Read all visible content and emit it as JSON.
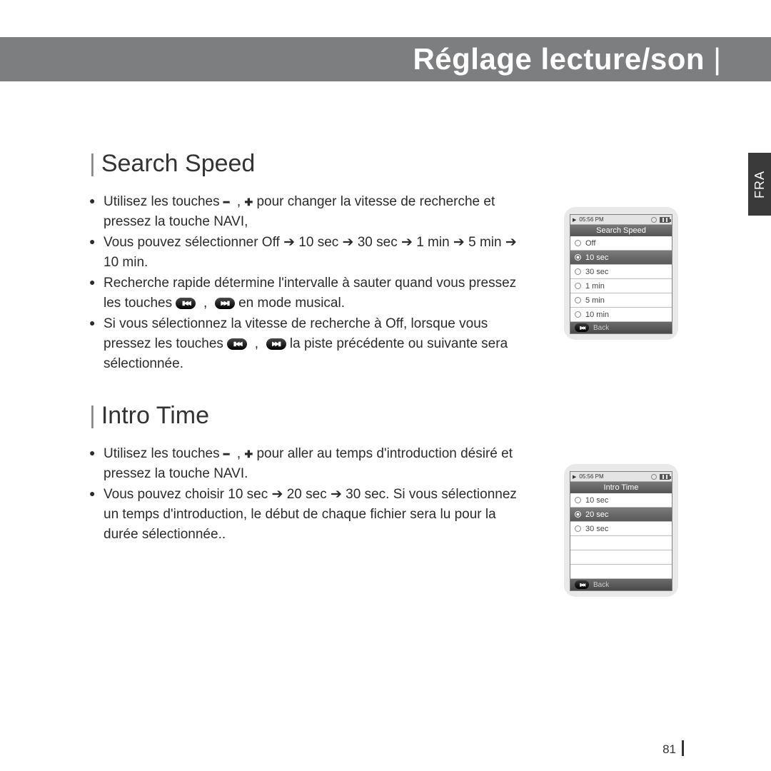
{
  "header": {
    "title": "Réglage lecture/son"
  },
  "side_tab": "FRA",
  "page_number": "81",
  "sections": {
    "search_speed": {
      "heading": "Search Speed",
      "b1a": "Utilisez les touches ",
      "b1b": " pour changer la vitesse de recherche et pressez la touche NAVI,",
      "b2": "Vous pouvez sélectionner Off ➔ 10 sec ➔ 30 sec ➔ 1 min ➔ 5 min ➔ 10 min.",
      "b3a": "Recherche rapide détermine l'intervalle à sauter quand vous pressez les touches ",
      "b3b": " en mode musical.",
      "b4a": "Si vous sélectionnez la vitesse de recherche à Off, lorsque vous pressez les touches ",
      "b4b": " la piste précédente ou suivante sera sélectionnée."
    },
    "intro_time": {
      "heading": "Intro Time",
      "b1a": "Utilisez les touches ",
      "b1b": " pour aller au temps d'introduction désiré et pressez la touche NAVI.",
      "b2": "Vous pouvez choisir 10 sec ➔ 20 sec ➔ 30 sec. Si vous sélectionnez un temps d'introduction, le début de chaque fichier sera lu pour la durée sélectionnée.."
    }
  },
  "devices": {
    "time": "05:56 PM",
    "back": "Back",
    "d1": {
      "title": "Search Speed",
      "items": [
        "Off",
        "10 sec",
        "30 sec",
        "1 min",
        "5 min",
        "10 min"
      ],
      "selected": 1
    },
    "d2": {
      "title": "Intro Time",
      "items": [
        "10 sec",
        "20 sec",
        "30 sec"
      ],
      "selected": 1
    }
  },
  "comma": ","
}
